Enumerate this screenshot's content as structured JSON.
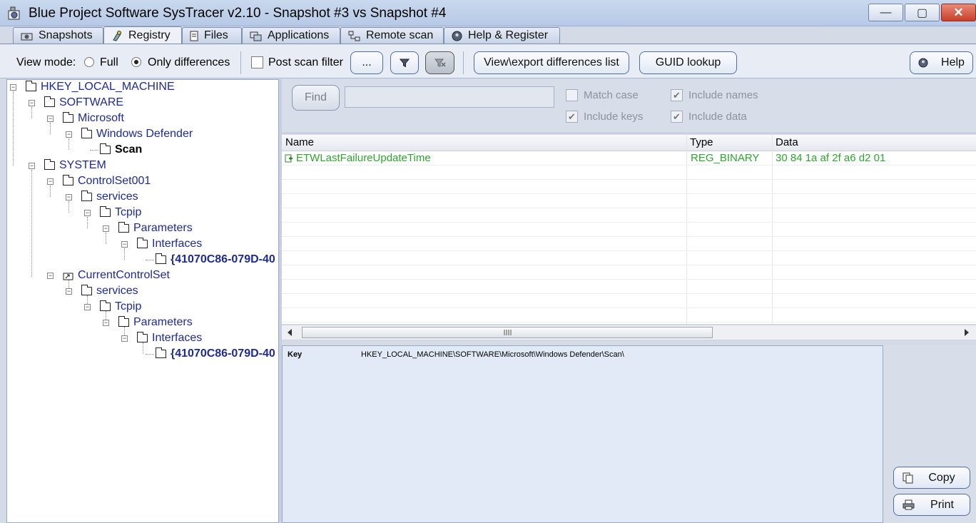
{
  "window": {
    "title": "Blue Project Software SysTracer v2.10 - Snapshot #3 vs Snapshot #4",
    "controls": {
      "minimize": "—",
      "maximize": "▢",
      "close": "✕"
    }
  },
  "tabs": [
    {
      "label": "Snapshots",
      "icon": "camera-icon"
    },
    {
      "label": "Registry",
      "icon": "registry-icon",
      "active": true
    },
    {
      "label": "Files",
      "icon": "file-icon"
    },
    {
      "label": "Applications",
      "icon": "applications-icon"
    },
    {
      "label": "Remote scan",
      "icon": "network-icon"
    },
    {
      "label": "Help & Register",
      "icon": "help-icon"
    }
  ],
  "toolbar": {
    "view_mode_label": "View mode:",
    "full_label": "Full",
    "only_diff_label": "Only differences",
    "selected_view_mode": "Only differences",
    "post_scan_filter_label": "Post scan filter",
    "post_scan_filter_checked": false,
    "ellipsis_label": "...",
    "view_export_label": "View\\export differences list",
    "guid_lookup_label": "GUID lookup",
    "help_label": "Help"
  },
  "tree": {
    "nodes": [
      {
        "label": "HKEY_LOCAL_MACHINE",
        "level": 0
      },
      {
        "label": "SOFTWARE",
        "level": 1
      },
      {
        "label": "Microsoft",
        "level": 2
      },
      {
        "label": "Windows Defender",
        "level": 3
      },
      {
        "label": "Scan",
        "level": 4,
        "selected": true
      },
      {
        "label": "SYSTEM",
        "level": 1
      },
      {
        "label": "ControlSet001",
        "level": 2
      },
      {
        "label": "services",
        "level": 3
      },
      {
        "label": "Tcpip",
        "level": 4
      },
      {
        "label": "Parameters",
        "level": 5
      },
      {
        "label": "Interfaces",
        "level": 6
      },
      {
        "label": "{41070C86-079D-40",
        "level": 7,
        "bold": true
      },
      {
        "label": "CurrentControlSet",
        "level": 2,
        "link": true
      },
      {
        "label": "services",
        "level": 3
      },
      {
        "label": "Tcpip",
        "level": 4
      },
      {
        "label": "Parameters",
        "level": 5
      },
      {
        "label": "Interfaces",
        "level": 6
      },
      {
        "label": "{41070C86-079D-40",
        "level": 7,
        "bold": true
      }
    ]
  },
  "find": {
    "button_label": "Find",
    "input_value": "",
    "match_case_label": "Match case",
    "match_case_checked": false,
    "include_names_label": "Include names",
    "include_names_checked": true,
    "include_keys_label": "Include keys",
    "include_keys_checked": true,
    "include_data_label": "Include data",
    "include_data_checked": true
  },
  "grid": {
    "columns": [
      "Name",
      "Type",
      "Data"
    ],
    "rows": [
      {
        "name": "ETWLastFailureUpdateTime",
        "type": "REG_BINARY",
        "data": "30 84 1a af 2f a6 d2 01",
        "status": "added"
      }
    ]
  },
  "details": {
    "key_label": "Key",
    "key_value": "HKEY_LOCAL_MACHINE\\SOFTWARE\\Microsoft\\Windows Defender\\Scan\\"
  },
  "side_buttons": {
    "copy_label": "Copy",
    "print_label": "Print"
  },
  "colors": {
    "added": "#2ea52e",
    "tree_text": "#1e2a96",
    "close": "#c8402a"
  }
}
